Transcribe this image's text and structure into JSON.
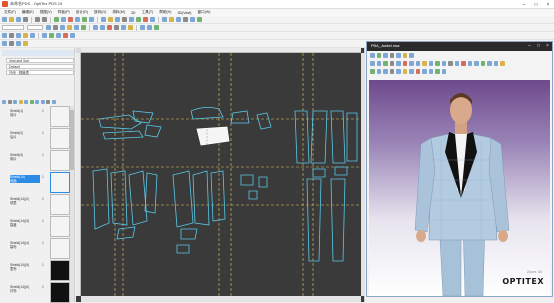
{
  "window": {
    "title": "未命名PDS - OptiTex PDS 19"
  },
  "menu": [
    "文件(F)",
    "编辑(E)",
    "视图(V)",
    "样板(P)",
    "设计(D)",
    "放码(G)",
    "排料(M)",
    "3D",
    "工具(T)",
    "帮助(H)",
    "3D(Vest)",
    "窗口(W)"
  ],
  "left_panel": {
    "field1": "Vest and Suit",
    "field2": "Default",
    "field3": "尺码 · 规格表",
    "pieces": [
      {
        "label": "Shield(1)",
        "sub": "前片",
        "count": "1"
      },
      {
        "label": "Shield(2)",
        "sub": "后片",
        "count": "1"
      },
      {
        "label": "Shield(3)",
        "sub": "侧片",
        "count": "1"
      },
      {
        "label": "Shield(14)",
        "sub": "领面",
        "count": "1"
      },
      {
        "label": "Shield(14)(2)",
        "sub": "领里",
        "count": "1"
      },
      {
        "label": "Shield(14)(3)",
        "sub": "袋盖",
        "count": "1"
      },
      {
        "label": "Shield(14)(4)",
        "sub": "袋布",
        "count": "1"
      },
      {
        "label": "Shield(14)(5)",
        "sub": "里布",
        "count": "1"
      },
      {
        "label": "Shield(14)(6)",
        "sub": "衬布",
        "count": "1"
      }
    ],
    "selected_index": 3
  },
  "window3d": {
    "title": "PBA_Jacket.msz",
    "brand": "OPTITEX",
    "zoom": "Zoom: 44"
  },
  "colors": {
    "canvas_bg": "#3a3a3a",
    "pattern_line": "#5bc8e8",
    "guide_line": "#e0c55a",
    "selected_piece": "#ffffff",
    "accent": "#2b8be6"
  },
  "icons": {
    "toolbar": [
      "new-file-icon",
      "open-icon",
      "save-icon",
      "print-icon",
      "undo-icon",
      "redo-icon",
      "zoom-icon",
      "select-icon",
      "line-tool-icon",
      "grade-icon"
    ],
    "window_controls": [
      "minimize-icon",
      "maximize-icon",
      "close-icon"
    ]
  }
}
